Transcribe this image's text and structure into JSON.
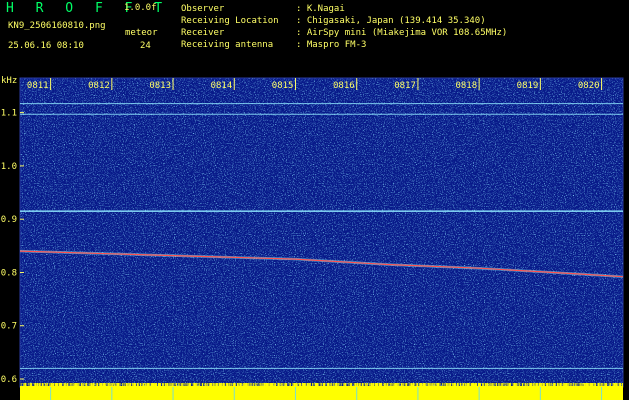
{
  "header": {
    "app_title": "H R O F F T",
    "version": "1.0.0f",
    "file_name": "KN9_2506160810.png",
    "meteor_label": "meteor",
    "meteor_count": "24",
    "datetime": "25.06.16 08:10",
    "info": [
      {
        "label": "Observer",
        "value": ": K.Nagai"
      },
      {
        "label": "Receiving Location",
        "value": ": Chigasaki, Japan (139.414 35.340)"
      },
      {
        "label": "Receiver",
        "value": ": AirSpy mini (Miakejima VOR 108.65MHz)"
      },
      {
        "label": "Receiving antenna",
        "value": ": Maspro FM-3"
      }
    ]
  },
  "colors": {
    "background": "#000000",
    "plot_bg": "#081a8a",
    "header_text": "#ffff66",
    "title_text": "#00ff66",
    "trace": "#ff5050",
    "reference_line": "#8fe8ff",
    "baseline": "#ffff00"
  },
  "chart_data": {
    "type": "heatmap",
    "y_unit": "kHz",
    "y_ticks": [
      "1.1",
      "1.0",
      "0.9",
      "0.8",
      "0.7",
      "0.6"
    ],
    "y_tick_values": [
      1.1,
      1.0,
      0.9,
      0.8,
      0.7,
      0.6
    ],
    "ylim": [
      0.585,
      1.165
    ],
    "x_ticks": [
      "0811",
      "0812",
      "0813",
      "0814",
      "0815",
      "0816",
      "0817",
      "0818",
      "0819",
      "0820"
    ],
    "x_tick_minutes": [
      11,
      12,
      13,
      14,
      15,
      16,
      17,
      18,
      19,
      20
    ],
    "xlim": [
      10.5,
      20.35
    ],
    "reference_lines_khz": [
      1.117,
      1.097,
      0.915,
      0.62
    ],
    "doppler_trace": [
      {
        "minute": 10.5,
        "khz": 0.84
      },
      {
        "minute": 12.0,
        "khz": 0.835
      },
      {
        "minute": 13.5,
        "khz": 0.83
      },
      {
        "minute": 15.0,
        "khz": 0.825
      },
      {
        "minute": 16.5,
        "khz": 0.815
      },
      {
        "minute": 18.0,
        "khz": 0.808
      },
      {
        "minute": 19.5,
        "khz": 0.798
      },
      {
        "minute": 20.35,
        "khz": 0.792
      }
    ]
  }
}
